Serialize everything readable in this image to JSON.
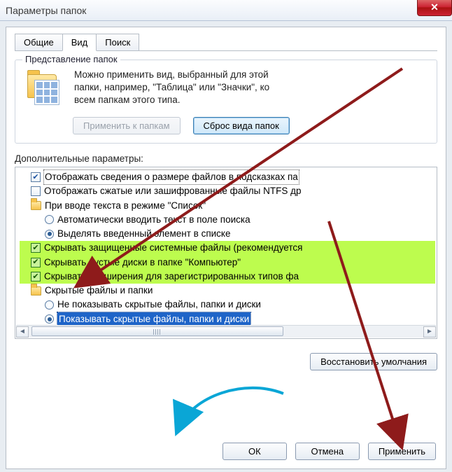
{
  "window": {
    "title": "Параметры папок",
    "close_glyph": "✕"
  },
  "tabs": {
    "general": "Общие",
    "view": "Вид",
    "search": "Поиск"
  },
  "folder_view": {
    "legend": "Представление папок",
    "text1": "Можно применить вид, выбранный для этой",
    "text2": "папки, например, \"Таблица\" или \"Значки\", ко",
    "text3": "всем папкам этого типа.",
    "apply_btn": "Применить к папкам",
    "reset_btn": "Сброс вида папок"
  },
  "advanced": {
    "label": "Дополнительные параметры:",
    "r1": "Отображать сведения о размере файлов в подсказках па",
    "r2": "Отображать сжатые или зашифрованные файлы NTFS др",
    "r3": "При вводе текста в режиме \"Список\"",
    "r3a": "Автоматически вводить текст в поле поиска",
    "r3b": "Выделять введенный элемент в списке",
    "r4": "Скрывать защищенные системные файлы (рекомендуется",
    "r5": "Скрывать пустые диски в папке \"Компьютер\"",
    "r6": "Скрывать расширения для зарегистрированных типов фа",
    "r7": "Скрытые файлы и папки",
    "r7a": "Не показывать скрытые файлы, папки и диски",
    "r7b": "Показывать скрытые файлы, папки и диски"
  },
  "restore_defaults": "Восстановить умолчания",
  "buttons": {
    "ok": "ОК",
    "cancel": "Отмена",
    "apply": "Применить"
  },
  "scroll": {
    "left": "◄",
    "right": "►"
  }
}
